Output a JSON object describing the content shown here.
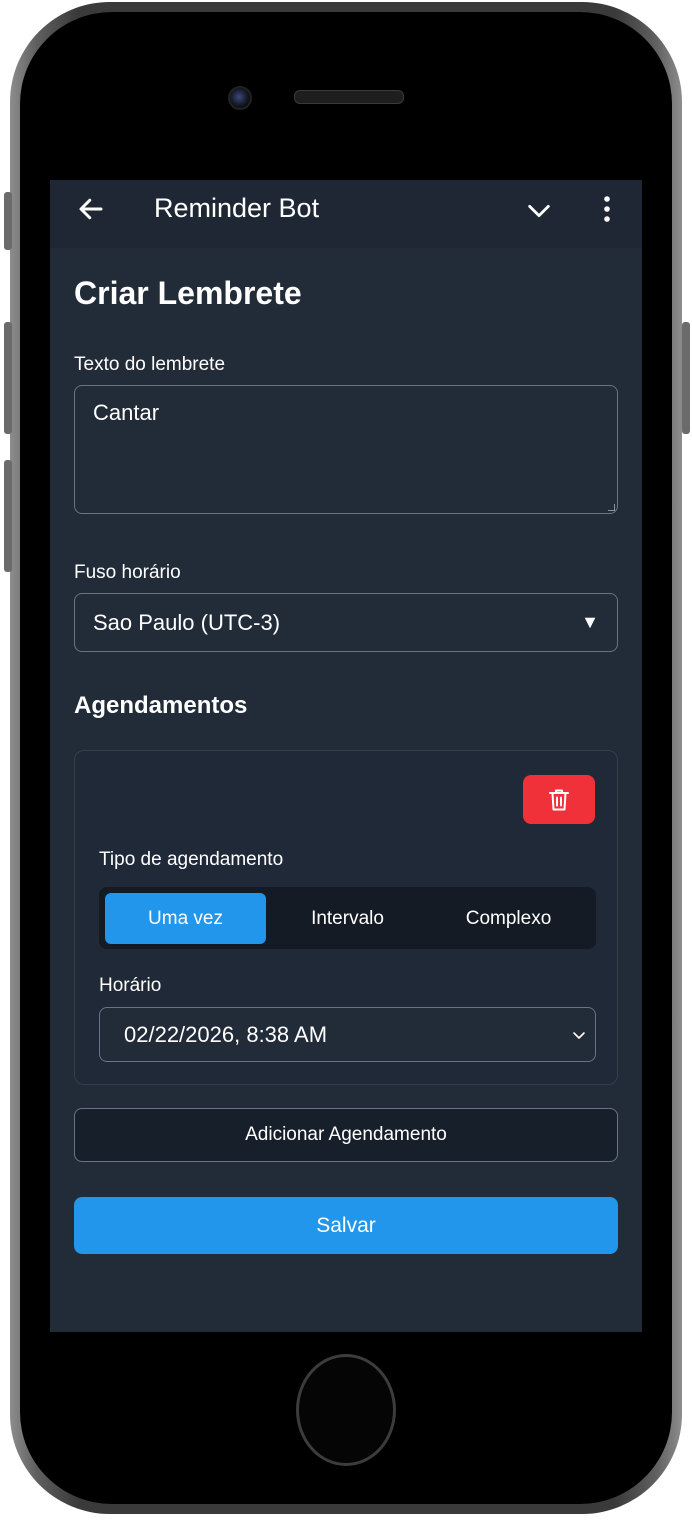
{
  "app_bar": {
    "title": "Reminder Bot",
    "back_icon": "arrow-left-icon",
    "expand_icon": "chevron-down-icon",
    "menu_icon": "more-vertical-icon"
  },
  "form": {
    "heading": "Criar Lembrete",
    "text_label": "Texto do lembrete",
    "text_value": "Cantar",
    "timezone_label": "Fuso horário",
    "timezone_value": "Sao Paulo (UTC-3)",
    "schedules_title": "Agendamentos"
  },
  "schedule": {
    "delete_icon": "trash-icon",
    "type_label": "Tipo de agendamento",
    "options": [
      "Uma vez",
      "Intervalo",
      "Complexo"
    ],
    "selected_option": "Uma vez",
    "time_label": "Horário",
    "time_value": "02/22/2026, 8:38 AM"
  },
  "actions": {
    "add_schedule": "Adicionar Agendamento",
    "save": "Salvar"
  },
  "colors": {
    "background": "#222b38",
    "accent": "#2196ea",
    "danger": "#f0313a"
  }
}
